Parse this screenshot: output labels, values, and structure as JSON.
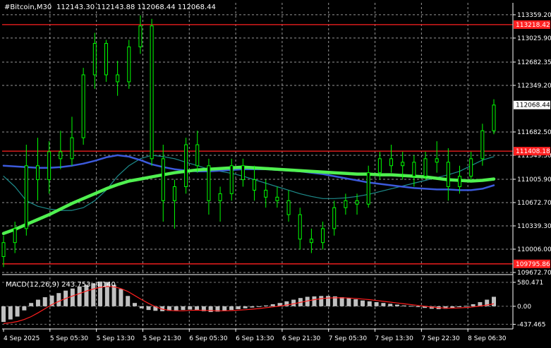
{
  "header": {
    "symbol_tf": "#Bitcoin,M30",
    "ohlc": "112143.30 112143.88 112068.44 112068.44"
  },
  "colors": {
    "background": "#000000",
    "grid": "#c8c8c8",
    "axis": "#ffffff",
    "candles": "#00ff00",
    "ma_fast": "#1e8c8c",
    "ma_mid": "#3c5adc",
    "ma_slow": "#50f050",
    "hline": "#ff2020",
    "macd_hist": "#c0c0c0",
    "macd_signal": "#ff1e1e"
  },
  "chart_data": [
    {
      "type": "line",
      "title": "#Bitcoin,M30",
      "ylim": [
        109672.7,
        113530
      ],
      "grid": true,
      "y_ticks": [
        "113359.20",
        "113025.90",
        "112682.35",
        "112349.20",
        "111682.50",
        "111349.30",
        "111005.90",
        "110672.70",
        "110339.30",
        "110006.00",
        "109672.70"
      ],
      "x_ticks": [
        "4 Sep 2025",
        "5 Sep 05:30",
        "5 Sep 13:30",
        "5 Sep 21:30",
        "6 Sep 05:30",
        "6 Sep 13:30",
        "6 Sep 21:30",
        "7 Sep 05:30",
        "7 Sep 13:30",
        "7 Sep 22:30",
        "8 Sep 06:30"
      ],
      "price_labels": [
        {
          "text": "113218.42",
          "value": 113218.42,
          "style": "hline"
        },
        {
          "text": "112068.44",
          "value": 112068.44,
          "style": "current"
        },
        {
          "text": "111408.18",
          "value": 111408.18,
          "style": "hline"
        },
        {
          "text": "109795.86",
          "value": 109795.86,
          "style": "hline"
        }
      ],
      "horizontal_lines": [
        113218.42,
        111408.18,
        109795.86
      ],
      "series": [
        {
          "style": "ma_fast",
          "values": [
            111050,
            110900,
            110700,
            110620,
            110580,
            110560,
            110560,
            110600,
            110700,
            110850,
            111050,
            111200,
            111300,
            111350,
            111330,
            111300,
            111250,
            111200,
            111150,
            111120,
            111090,
            111050,
            111000,
            110950,
            110900,
            110850,
            110800,
            110760,
            110730,
            110730,
            110740,
            110760,
            110790,
            110830,
            110870,
            110910,
            110950,
            110990,
            111030,
            111070,
            111120,
            111200,
            111280,
            111330
          ]
        },
        {
          "style": "ma_mid",
          "values": [
            111200,
            111190,
            111180,
            111170,
            111170,
            111180,
            111200,
            111230,
            111270,
            111320,
            111350,
            111330,
            111280,
            111220,
            111180,
            111150,
            111130,
            111120,
            111120,
            111130,
            111140,
            111150,
            111150,
            111150,
            111140,
            111130,
            111120,
            111100,
            111080,
            111050,
            111020,
            110990,
            110960,
            110940,
            110920,
            110900,
            110880,
            110870,
            110860,
            110860,
            110850,
            110850,
            110870,
            110920
          ]
        },
        {
          "style": "ma_slow",
          "values": [
            110230,
            110290,
            110360,
            110430,
            110500,
            110580,
            110660,
            110730,
            110800,
            110870,
            110930,
            110980,
            111010,
            111040,
            111070,
            111100,
            111120,
            111140,
            111150,
            111160,
            111170,
            111180,
            111170,
            111160,
            111150,
            111140,
            111130,
            111120,
            111110,
            111100,
            111090,
            111080,
            111080,
            111070,
            111070,
            111060,
            111050,
            111040,
            111020,
            111000,
            110990,
            110980,
            110990,
            111010
          ]
        }
      ],
      "candles": [
        {
          "o": 109900,
          "h": 110200,
          "l": 109750,
          "c": 110100
        },
        {
          "o": 110100,
          "h": 110400,
          "l": 109950,
          "c": 110300
        },
        {
          "o": 110300,
          "h": 111500,
          "l": 110200,
          "c": 111200
        },
        {
          "o": 111200,
          "h": 111600,
          "l": 110700,
          "c": 111000
        },
        {
          "o": 111000,
          "h": 111550,
          "l": 110800,
          "c": 111400
        },
        {
          "o": 111400,
          "h": 111700,
          "l": 111150,
          "c": 111300
        },
        {
          "o": 111300,
          "h": 111900,
          "l": 111200,
          "c": 111600
        },
        {
          "o": 111600,
          "h": 112600,
          "l": 111500,
          "c": 112500
        },
        {
          "o": 112500,
          "h": 113100,
          "l": 112300,
          "c": 112950
        },
        {
          "o": 112950,
          "h": 113000,
          "l": 112400,
          "c": 112500
        },
        {
          "o": 112500,
          "h": 112700,
          "l": 112200,
          "c": 112400
        },
        {
          "o": 112400,
          "h": 113000,
          "l": 112300,
          "c": 112900
        },
        {
          "o": 112900,
          "h": 113350,
          "l": 112800,
          "c": 113200
        },
        {
          "o": 113200,
          "h": 113300,
          "l": 111200,
          "c": 111300
        },
        {
          "o": 111300,
          "h": 111500,
          "l": 110400,
          "c": 110700
        },
        {
          "o": 110700,
          "h": 111000,
          "l": 110300,
          "c": 110900
        },
        {
          "o": 110900,
          "h": 111600,
          "l": 110800,
          "c": 111500
        },
        {
          "o": 111500,
          "h": 111700,
          "l": 111100,
          "c": 111200
        },
        {
          "o": 111200,
          "h": 111300,
          "l": 110500,
          "c": 110700
        },
        {
          "o": 110700,
          "h": 110900,
          "l": 110400,
          "c": 110800
        },
        {
          "o": 110800,
          "h": 111300,
          "l": 110700,
          "c": 111200
        },
        {
          "o": 111200,
          "h": 111300,
          "l": 110900,
          "c": 111000
        },
        {
          "o": 111000,
          "h": 111200,
          "l": 110700,
          "c": 110850
        },
        {
          "o": 110850,
          "h": 111000,
          "l": 110600,
          "c": 110750
        },
        {
          "o": 110750,
          "h": 110900,
          "l": 110600,
          "c": 110700
        },
        {
          "o": 110700,
          "h": 110850,
          "l": 110400,
          "c": 110500
        },
        {
          "o": 110500,
          "h": 110600,
          "l": 110000,
          "c": 110150
        },
        {
          "o": 110150,
          "h": 110300,
          "l": 109950,
          "c": 110100
        },
        {
          "o": 110100,
          "h": 110400,
          "l": 110000,
          "c": 110300
        },
        {
          "o": 110300,
          "h": 110700,
          "l": 110200,
          "c": 110600
        },
        {
          "o": 110600,
          "h": 110800,
          "l": 110500,
          "c": 110700
        },
        {
          "o": 110700,
          "h": 110800,
          "l": 110500,
          "c": 110650
        },
        {
          "o": 110650,
          "h": 111200,
          "l": 110600,
          "c": 111100
        },
        {
          "o": 111100,
          "h": 111400,
          "l": 111000,
          "c": 111300
        },
        {
          "o": 111300,
          "h": 111500,
          "l": 111100,
          "c": 111200
        },
        {
          "o": 111200,
          "h": 111400,
          "l": 111000,
          "c": 111250
        },
        {
          "o": 111250,
          "h": 111350,
          "l": 110900,
          "c": 111050
        },
        {
          "o": 111050,
          "h": 111400,
          "l": 111000,
          "c": 111300
        },
        {
          "o": 111300,
          "h": 111550,
          "l": 111100,
          "c": 111250
        },
        {
          "o": 111250,
          "h": 111450,
          "l": 110700,
          "c": 110900
        },
        {
          "o": 110900,
          "h": 111200,
          "l": 110800,
          "c": 111050
        },
        {
          "o": 111050,
          "h": 111400,
          "l": 111000,
          "c": 111300
        },
        {
          "o": 111300,
          "h": 111800,
          "l": 111200,
          "c": 111700
        },
        {
          "o": 111700,
          "h": 112150,
          "l": 111650,
          "c": 112068
        }
      ]
    },
    {
      "type": "bar",
      "title": "MACD(12,26,9) 243.753 -4.140",
      "ylim": [
        -550,
        700
      ],
      "y_ticks": [
        "580.471",
        "0.00",
        "-437.465"
      ],
      "histogram": [
        -380,
        -320,
        -250,
        -100,
        80,
        160,
        220,
        260,
        320,
        380,
        430,
        480,
        520,
        560,
        600,
        590,
        520,
        420,
        250,
        80,
        -50,
        -90,
        -110,
        -120,
        -110,
        -100,
        -90,
        -80,
        -100,
        -120,
        -140,
        -130,
        -110,
        -90,
        -70,
        -50,
        -30,
        -10,
        20,
        50,
        80,
        120,
        160,
        200,
        230,
        240,
        250,
        250,
        240,
        220,
        200,
        170,
        140,
        120,
        100,
        80,
        60,
        40,
        20,
        10,
        -20,
        -40,
        -60,
        -70,
        -60,
        -40,
        -20,
        10,
        50,
        100,
        160,
        230
      ],
      "signal": [
        -420,
        -400,
        -370,
        -320,
        -250,
        -160,
        -60,
        40,
        120,
        190,
        250,
        310,
        370,
        420,
        460,
        480,
        470,
        430,
        360,
        260,
        160,
        70,
        -10,
        -70,
        -100,
        -110,
        -110,
        -100,
        -95,
        -100,
        -105,
        -110,
        -110,
        -105,
        -95,
        -85,
        -70,
        -55,
        -35,
        -15,
        5,
        30,
        60,
        95,
        130,
        160,
        185,
        200,
        205,
        205,
        200,
        190,
        175,
        160,
        140,
        120,
        100,
        80,
        60,
        40,
        20,
        0,
        -20,
        -35,
        -45,
        -45,
        -40,
        -30,
        -15,
        5,
        30,
        60
      ]
    }
  ]
}
